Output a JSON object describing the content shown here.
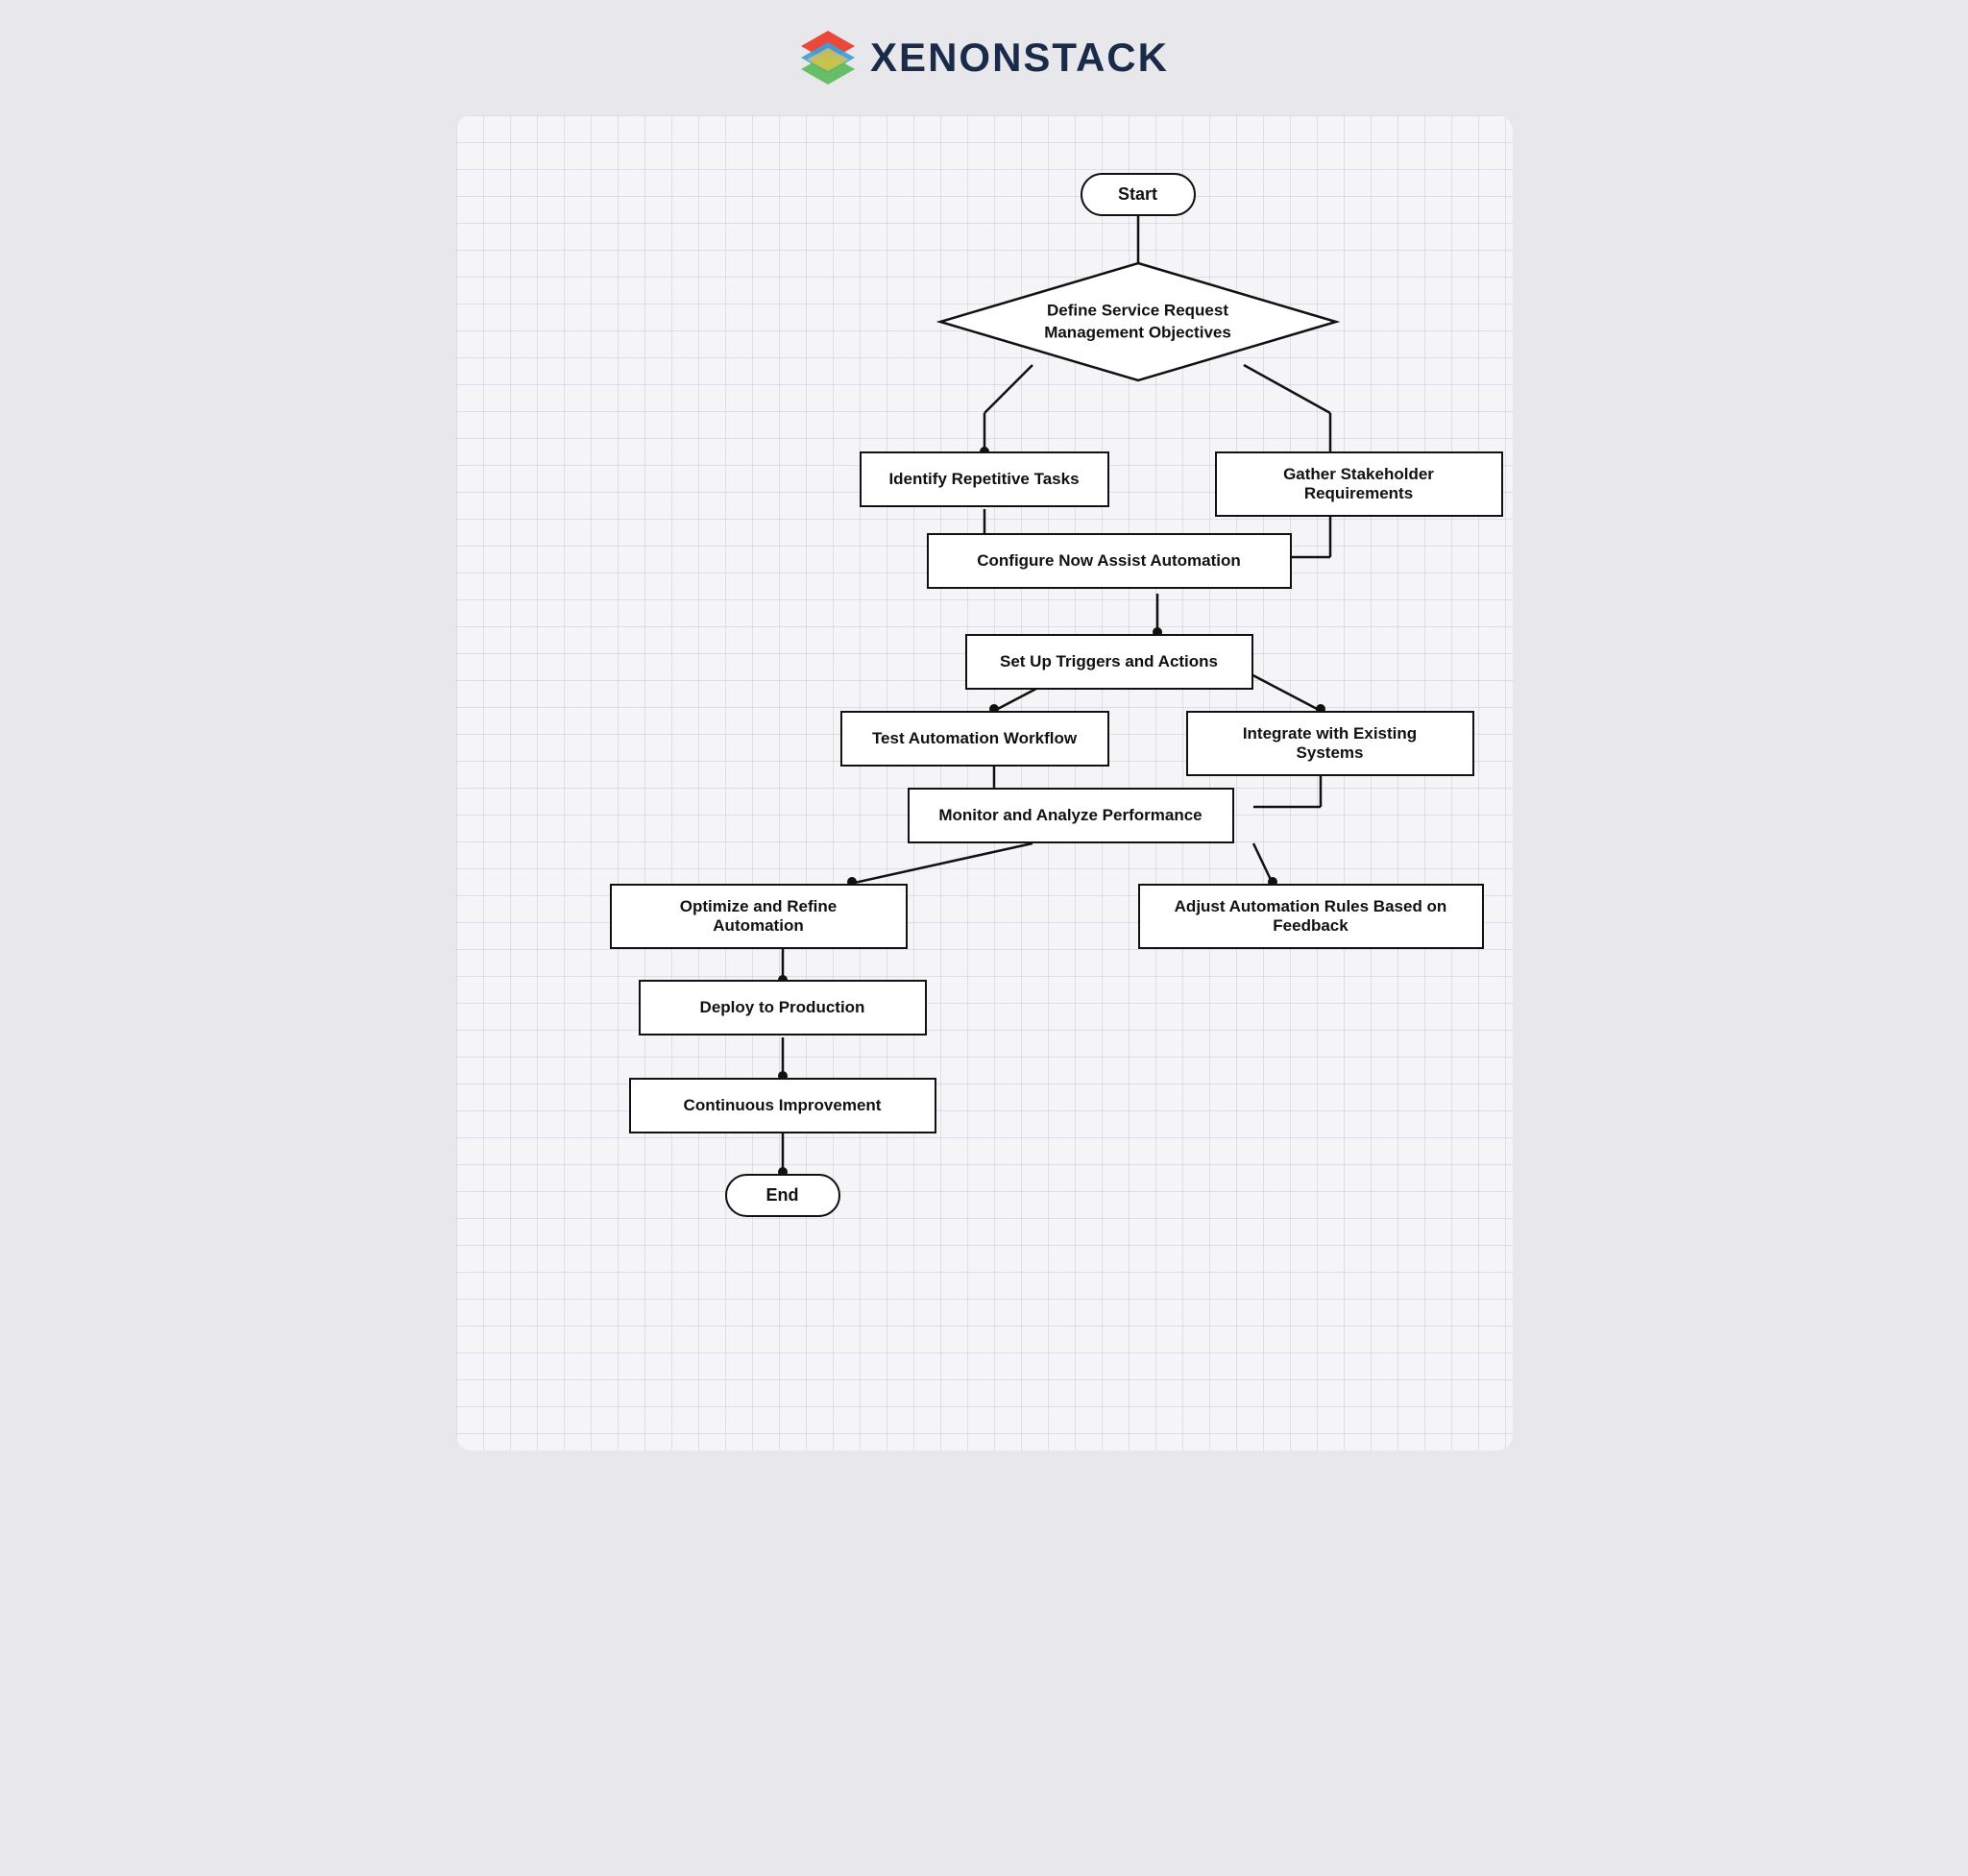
{
  "header": {
    "brand": "XENONSTACK"
  },
  "nodes": {
    "start": "Start",
    "define": "Define Service Request\nManagement Objectives",
    "identify": "Identify Repetitive Tasks",
    "gather": "Gather Stakeholder Requirements",
    "configure": "Configure Now Assist Automation",
    "setup": "Set Up Triggers and Actions",
    "test": "Test Automation Workflow",
    "integrate": "Integrate with Existing Systems",
    "monitor": "Monitor and Analyze Performance",
    "optimize": "Optimize and Refine Automation",
    "adjust": "Adjust Automation Rules Based on Feedback",
    "deploy": "Deploy to Production",
    "continuous": "Continuous Improvement",
    "end": "End"
  }
}
